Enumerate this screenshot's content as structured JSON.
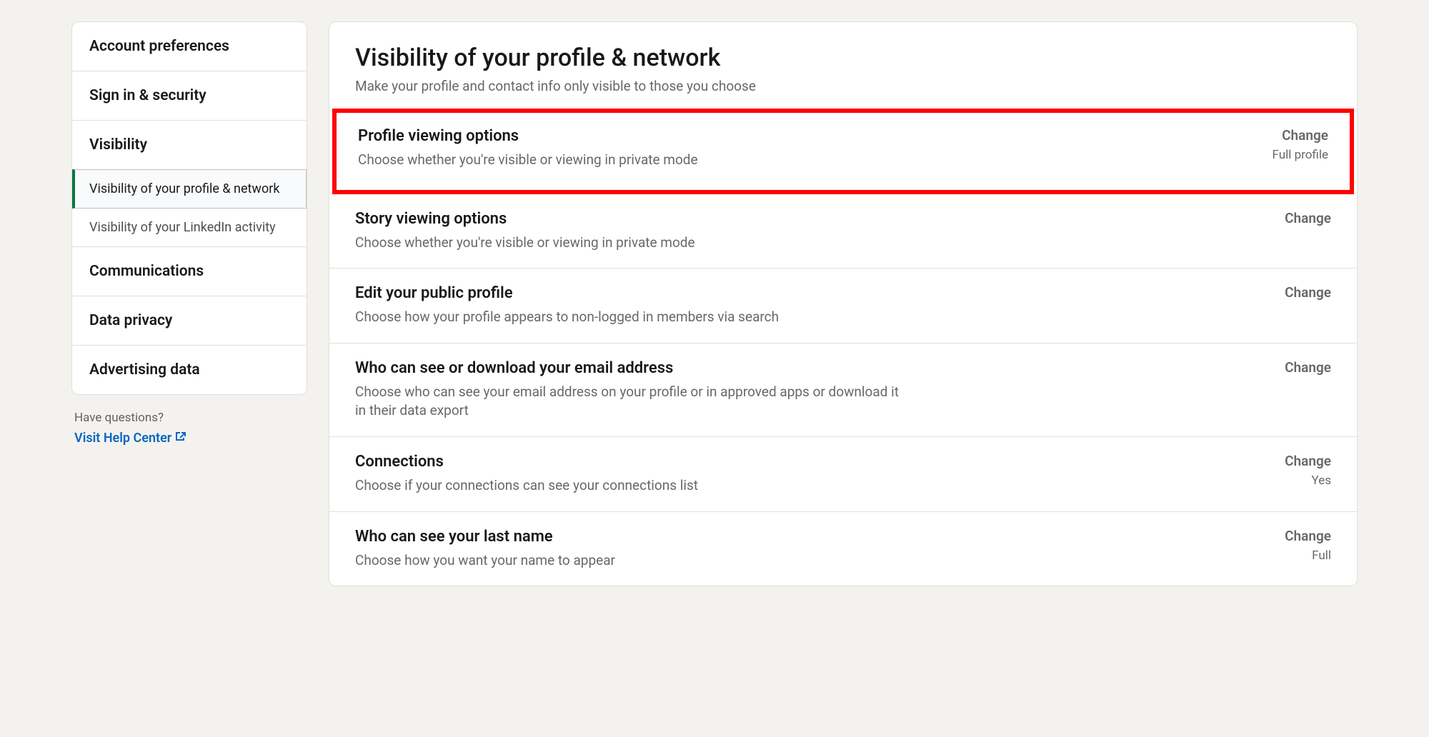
{
  "sidebar": {
    "items": [
      {
        "label": "Account preferences"
      },
      {
        "label": "Sign in & security"
      },
      {
        "label": "Visibility"
      },
      {
        "label": "Communications"
      },
      {
        "label": "Data privacy"
      },
      {
        "label": "Advertising data"
      }
    ],
    "subitems": [
      {
        "label": "Visibility of your profile & network"
      },
      {
        "label": "Visibility of your LinkedIn activity"
      }
    ]
  },
  "help": {
    "question": "Have questions?",
    "link": "Visit Help Center"
  },
  "main": {
    "title": "Visibility of your profile & network",
    "subtitle": "Make your profile and contact info only visible to those you choose",
    "change_label": "Change",
    "settings": [
      {
        "title": "Profile viewing options",
        "desc": "Choose whether you're visible or viewing in private mode",
        "value": "Full profile"
      },
      {
        "title": "Story viewing options",
        "desc": "Choose whether you're visible or viewing in private mode",
        "value": ""
      },
      {
        "title": "Edit your public profile",
        "desc": "Choose how your profile appears to non-logged in members via search",
        "value": ""
      },
      {
        "title": "Who can see or download your email address",
        "desc": "Choose who can see your email address on your profile or in approved apps or download it in their data export",
        "value": ""
      },
      {
        "title": "Connections",
        "desc": "Choose if your connections can see your connections list",
        "value": "Yes"
      },
      {
        "title": "Who can see your last name",
        "desc": "Choose how you want your name to appear",
        "value": "Full"
      }
    ]
  }
}
